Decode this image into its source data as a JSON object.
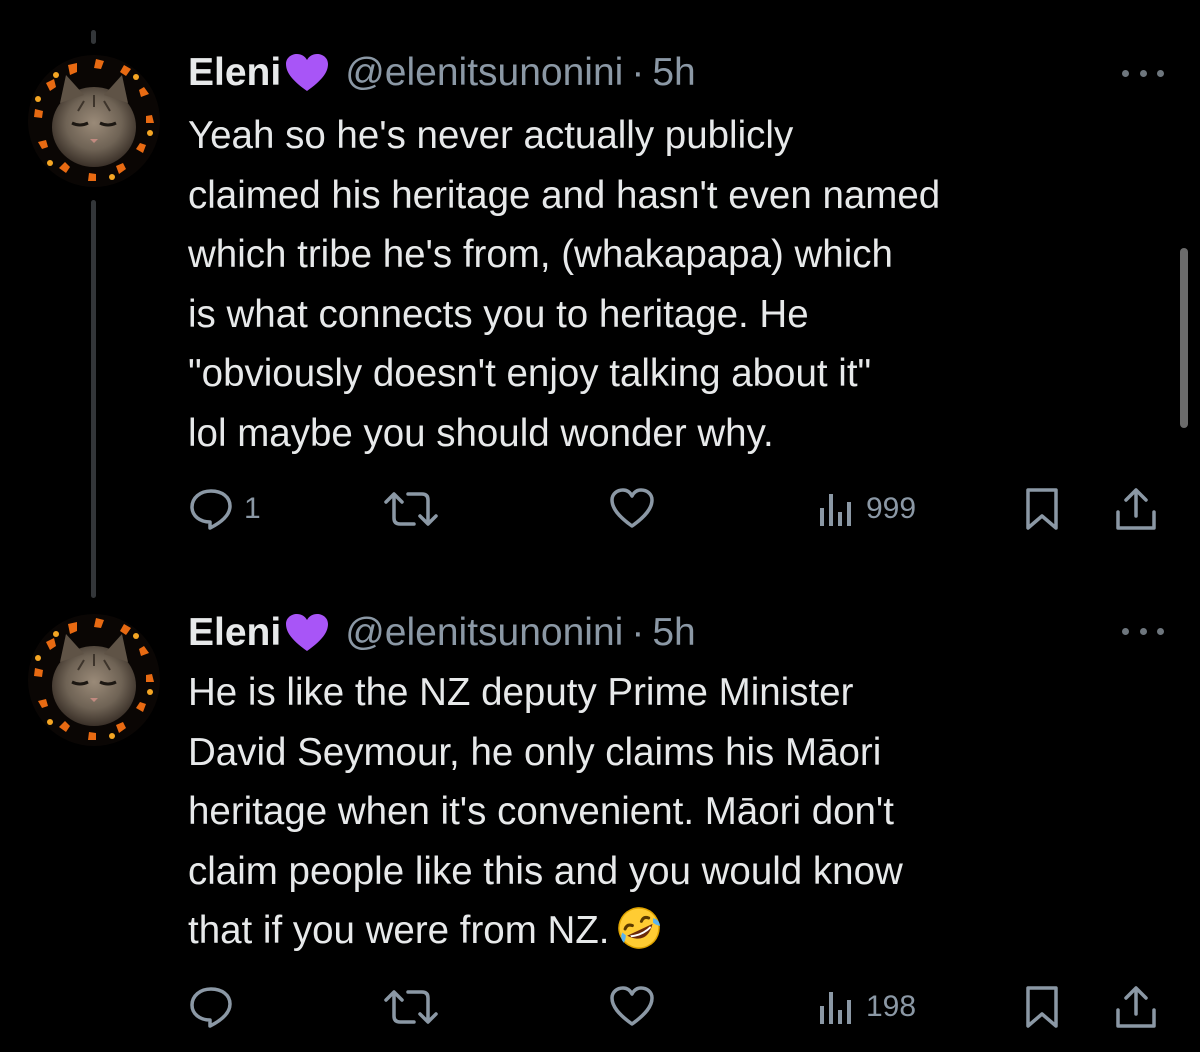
{
  "colors": {
    "background": "#000000",
    "primary_text": "#e7e9ea",
    "secondary_text": "#8b98a5",
    "thread_line": "#333639",
    "heart_emoji": "#a855f7"
  },
  "tweets": [
    {
      "display_name": "Eleni",
      "name_emoji": "purple-heart-icon",
      "handle": "@elenitsunonini",
      "separator": "·",
      "time": "5h",
      "text": "Yeah so he's never actually publicly\nclaimed his heritage and hasn't even named\nwhich tribe he's from, (whakapapa) which\nis what connects you to heritage. He\n\"obviously doesn't enjoy talking about it\"\nlol maybe you should wonder why.",
      "reply_count": "1",
      "retweet_count": "",
      "like_count": "",
      "view_count": "999"
    },
    {
      "display_name": "Eleni",
      "name_emoji": "purple-heart-icon",
      "handle": "@elenitsunonini",
      "separator": "·",
      "time": "5h",
      "text": "He is like the NZ deputy Prime Minister\nDavid Seymour, he only claims his Māori\nheritage when it's convenient. Māori don't\nclaim people like this and you would know\nthat if you were from NZ.",
      "text_emoji": "rolling-on-floor-laughing-icon",
      "reply_count": "",
      "retweet_count": "",
      "like_count": "",
      "view_count": "198"
    }
  ]
}
